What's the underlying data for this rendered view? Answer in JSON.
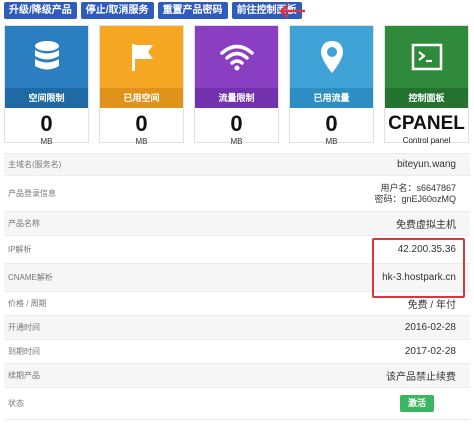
{
  "toolbar": {
    "buttons": [
      "升级/降级产品",
      "停止/取消服务",
      "重置产品密码",
      "前往控制面板"
    ]
  },
  "cards": [
    {
      "label": "空间限制",
      "value": "0",
      "unit": "MB",
      "icon": "database-icon"
    },
    {
      "label": "已用空间",
      "value": "0",
      "unit": "MB",
      "icon": "flag-icon"
    },
    {
      "label": "流量限制",
      "value": "0",
      "unit": "MB",
      "icon": "wifi-icon"
    },
    {
      "label": "已用流量",
      "value": "0",
      "unit": "MB",
      "icon": "map-pin-icon"
    },
    {
      "label": "控制面板",
      "value": "CPANEL",
      "unit": "Control panel",
      "icon": "terminal-icon"
    }
  ],
  "details": {
    "hostname": {
      "label": "主域名(服务名)",
      "value": "biteyun.wang"
    },
    "login": {
      "label": "产品登录信息",
      "username": "用户名：s6647867",
      "password": "密码：gnEJ60ozMQ"
    },
    "product": {
      "label": "产品名称",
      "value": "免费虚拟主机"
    },
    "ip": {
      "label": "IP解析",
      "value": "42.200.35.36"
    },
    "cname": {
      "label": "CNAME解析",
      "value": "hk-3.hostpark.cn"
    },
    "price": {
      "label": "价格 / 周期",
      "value": "免费 / 年付"
    },
    "opened": {
      "label": "开通时间",
      "value": "2016-02-28"
    },
    "expires": {
      "label": "到期时间",
      "value": "2017-02-28"
    },
    "renew": {
      "label": "续期产品",
      "value": "该产品禁止续费"
    },
    "status": {
      "label": "状态",
      "button": "激活"
    }
  },
  "colors": {
    "toolbar_button": "#2f5bbd",
    "highlight": "#d9363e",
    "activate": "#3bb561"
  }
}
